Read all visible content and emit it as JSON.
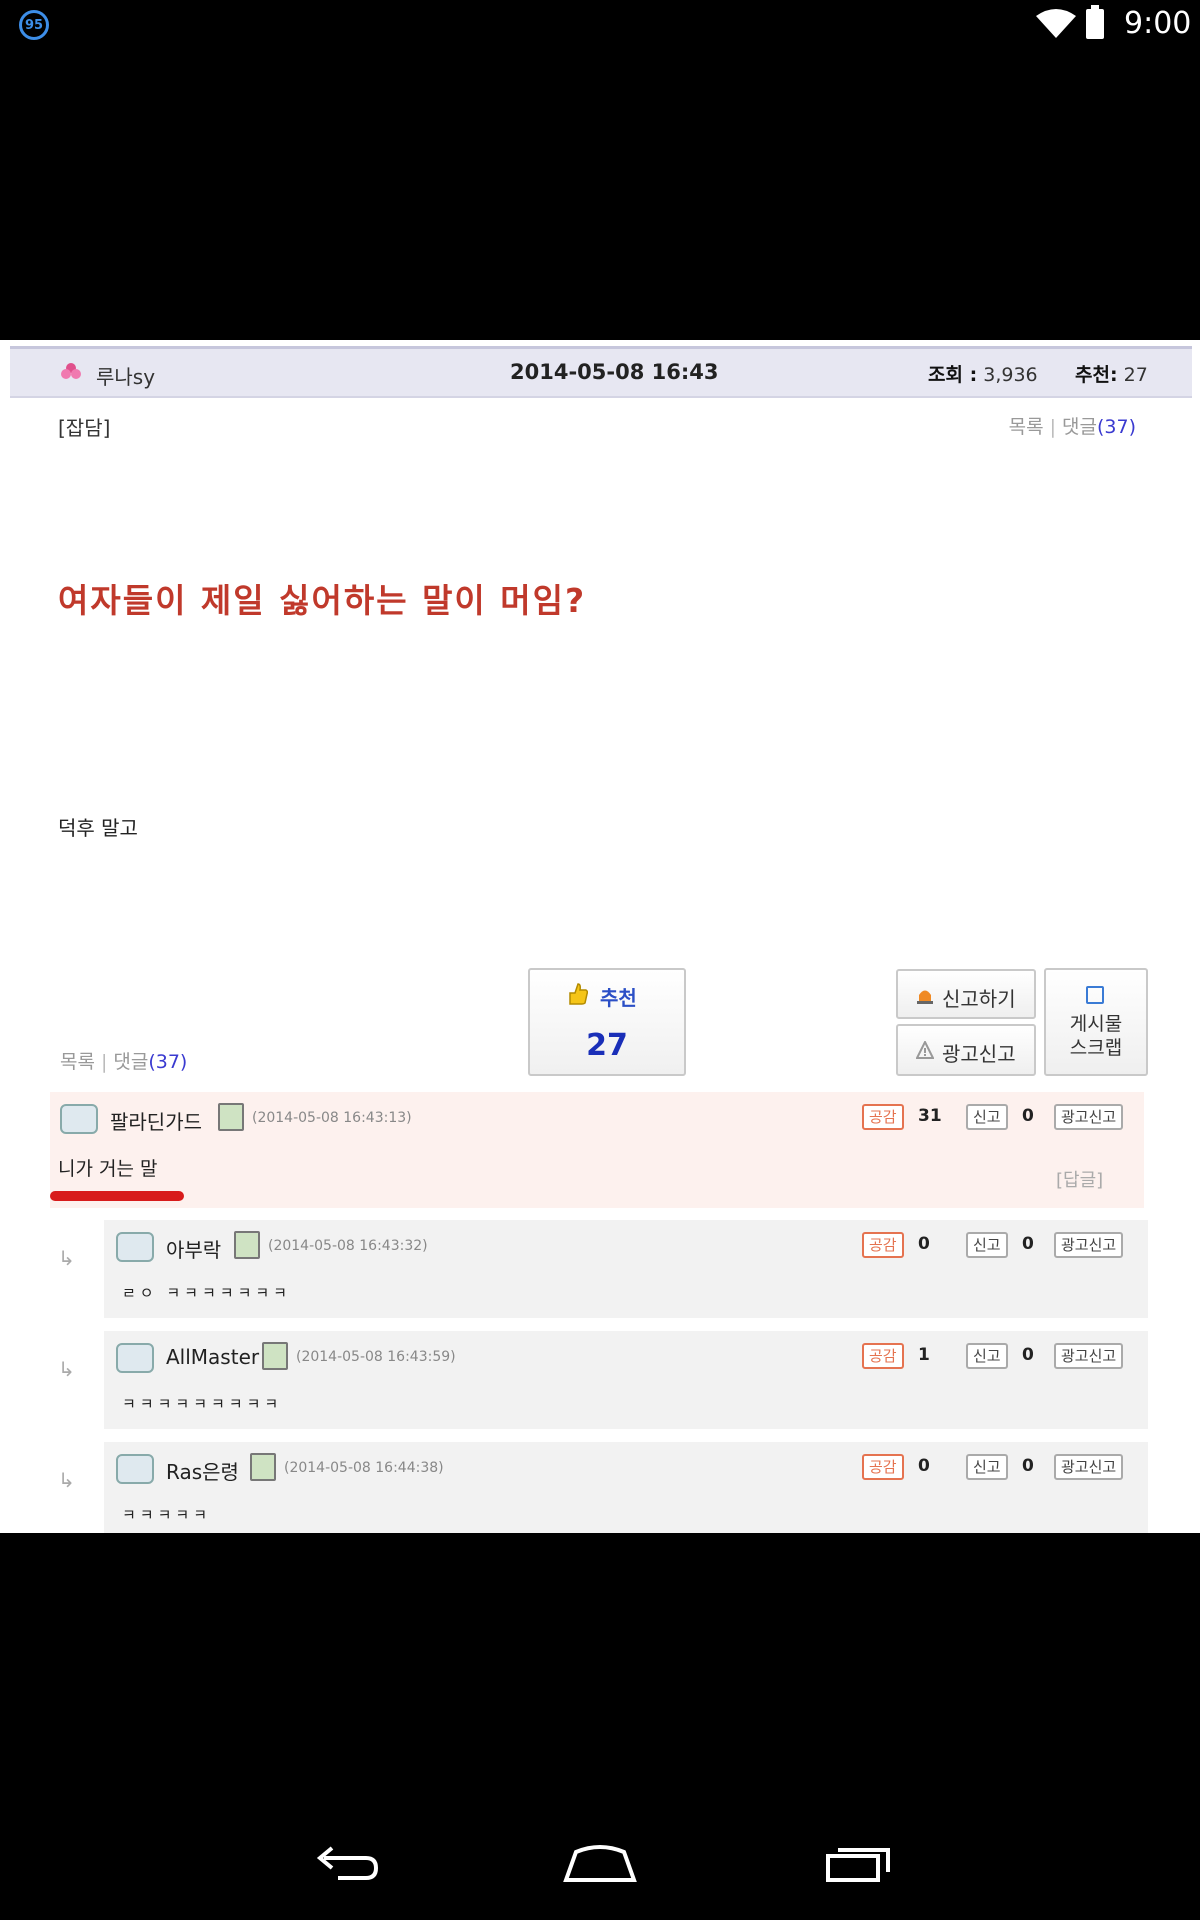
{
  "status_bar": {
    "notification_badge": "95",
    "time": "9:00",
    "icons": [
      "wifi-icon",
      "battery-icon"
    ]
  },
  "post": {
    "author": "루나sy",
    "date": "2014-05-08 16:43",
    "views_label": "조회 :",
    "views": "3,936",
    "recs_label": "추천:",
    "recs": "27",
    "category": "[잡담]",
    "list_link": "목록",
    "comments_link": "댓글",
    "comments_count": "(37)",
    "title": "여자들이 제일 싫어하는 말이 머임?",
    "body": "덕후 말고"
  },
  "actions": {
    "recommend_label": "추천",
    "recommend_count": "27",
    "report_label": "신고하기",
    "ad_report_label": "광고신고",
    "scrap_label_line1": "게시물",
    "scrap_label_line2": "스크랩"
  },
  "comment_labels": {
    "agree": "공감",
    "report": "신고",
    "ad_report": "광고신고",
    "reply": "[답글]"
  },
  "comments": [
    {
      "author": "팔라딘가드",
      "time": "(2014-05-08 16:43:13)",
      "text": "니가 거는 말",
      "agree": "31",
      "report": "0"
    },
    {
      "author": "아부락",
      "time": "(2014-05-08 16:43:32)",
      "text": "ㄹㅇ ㅋㅋㅋㅋㅋㅋㅋ",
      "agree": "0",
      "report": "0"
    },
    {
      "author": "AllMaster",
      "time": "(2014-05-08 16:43:59)",
      "text": "ㅋㅋㅋㅋㅋㅋㅋㅋㅋ",
      "agree": "1",
      "report": "0"
    },
    {
      "author": "Ras은령",
      "time": "(2014-05-08 16:44:38)",
      "text": "ㅋㅋㅋㅋㅋ",
      "agree": "0",
      "report": "0"
    }
  ],
  "colors": {
    "title_red": "#c0392b",
    "accent_blue": "#2b4fc6",
    "highlight_comment_bg": "#fdf1ee",
    "underline_red": "#d81b1b"
  }
}
